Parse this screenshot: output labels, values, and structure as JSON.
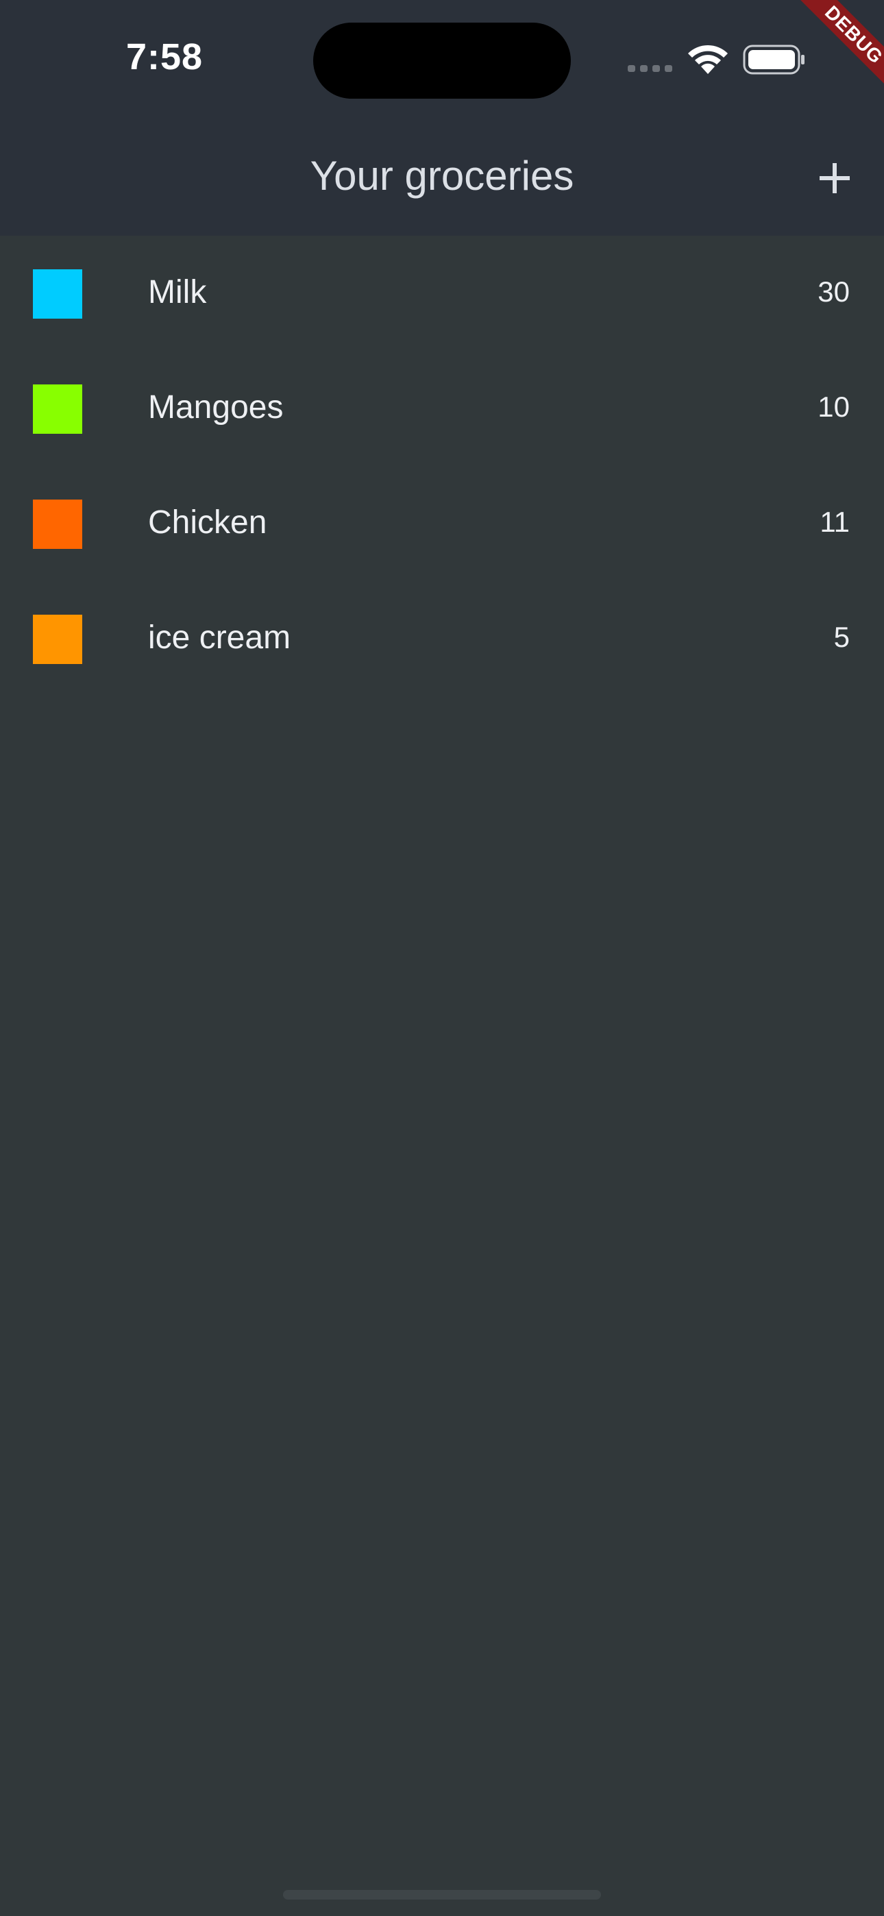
{
  "status_bar": {
    "time": "7:58",
    "icons": [
      "cellular-signal-icon",
      "wifi-icon",
      "battery-icon"
    ]
  },
  "debug_banner": "DEBUG",
  "app_bar": {
    "title": "Your groceries",
    "add_icon": "plus-icon"
  },
  "groceries": [
    {
      "name": "Milk",
      "quantity": "30",
      "color": "#00ccff"
    },
    {
      "name": "Mangoes",
      "quantity": "10",
      "color": "#88ff00"
    },
    {
      "name": "Chicken",
      "quantity": "11",
      "color": "#ff6600"
    },
    {
      "name": "ice cream",
      "quantity": "5",
      "color": "#ff9500"
    }
  ],
  "colors": {
    "header_background": "#2b313a",
    "body_background": "#31383a",
    "debug_banner": "#8a1a1c"
  }
}
